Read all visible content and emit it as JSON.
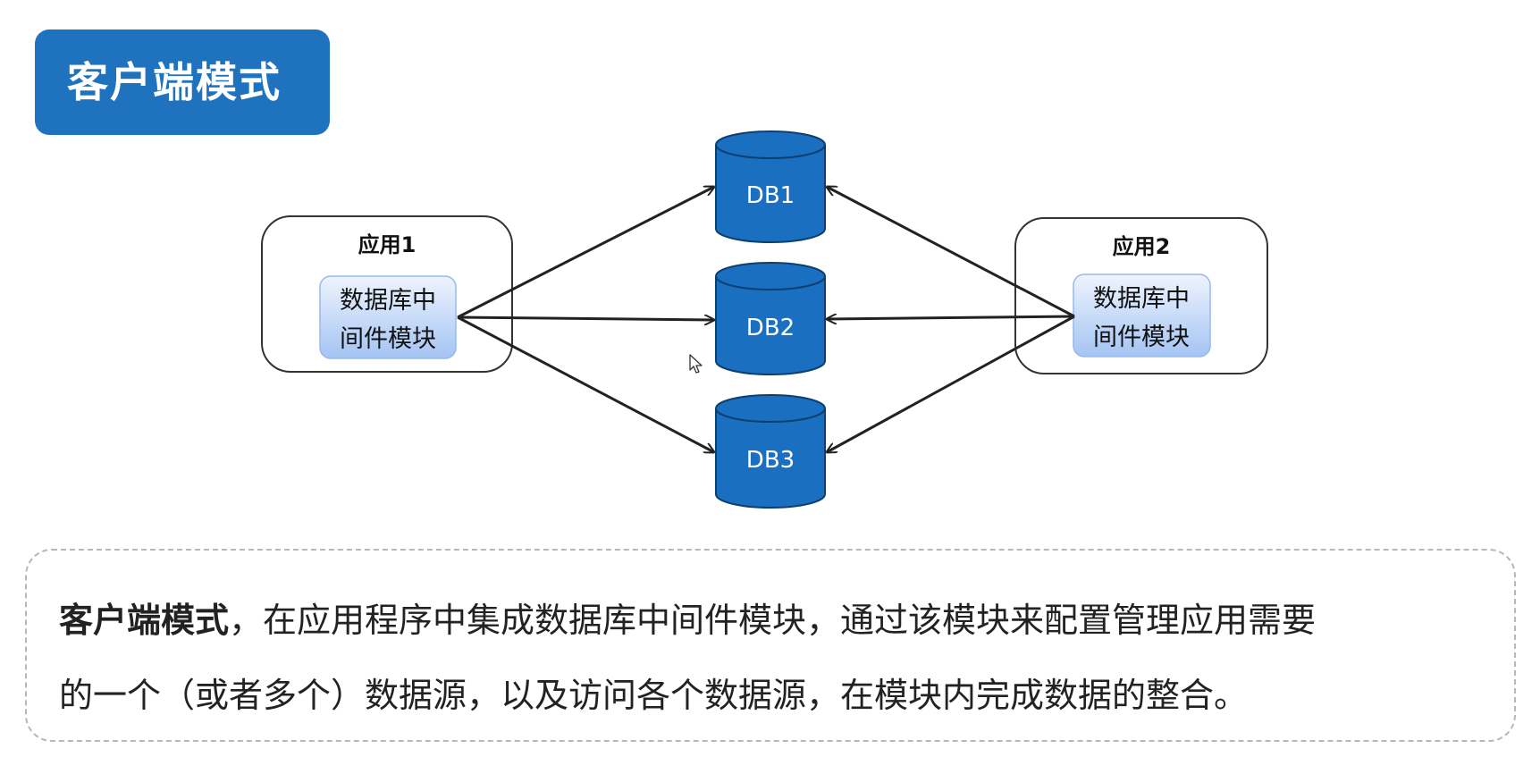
{
  "title": "客户端模式",
  "apps": [
    {
      "name": "应用1",
      "module": [
        "数据库中",
        "间件模块"
      ]
    },
    {
      "name": "应用2",
      "module": [
        "数据库中",
        "间件模块"
      ]
    }
  ],
  "databases": [
    "DB1",
    "DB2",
    "DB3"
  ],
  "description": {
    "lead": "客户端模式",
    "line1_rest": "，在应用程序中集成数据库中间件模块，通过该模块来配置管理应用需要",
    "line2": "的一个（或者多个）数据源，以及访问各个数据源，在模块内完成数据的整合。"
  },
  "colors": {
    "accent": "#1f72bd",
    "db_fill": "#1a6fc0",
    "db_stroke": "#0d3f70",
    "module_fill_top": "#e9f1fd",
    "module_fill_bottom": "#a9c8f4"
  },
  "icons": {
    "pointer": "mouse-cursor-icon"
  }
}
